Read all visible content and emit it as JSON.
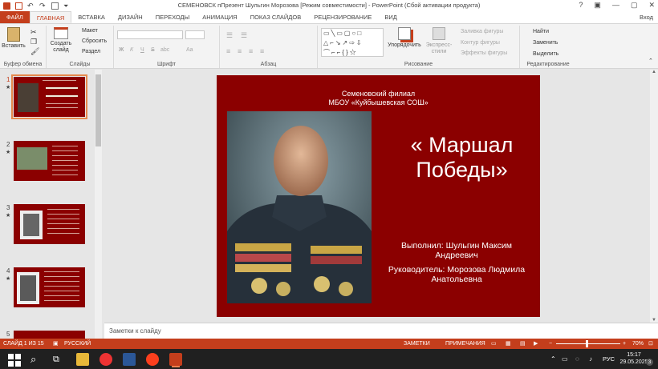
{
  "window": {
    "title": "СЕМЕНОВСК  пПрезент Шульгин Морозова [Режим совместимости] - PowerPoint (Сбой активации продукта)",
    "controls": [
      "?",
      "▣",
      "—",
      "▢",
      "✕"
    ]
  },
  "tabs": [
    {
      "label": "ФАЙЛ"
    },
    {
      "label": "ГЛАВНАЯ"
    },
    {
      "label": "ВСТАВКА"
    },
    {
      "label": "ДИЗАЙН"
    },
    {
      "label": "ПЕРЕХОДЫ"
    },
    {
      "label": "АНИМАЦИЯ"
    },
    {
      "label": "ПОКАЗ СЛАЙДОВ"
    },
    {
      "label": "РЕЦЕНЗИРОВАНИЕ"
    },
    {
      "label": "ВИД"
    }
  ],
  "signin": "Вход",
  "ribbon": {
    "clipboard": {
      "label": "Буфер обмена",
      "paste": "Вставить"
    },
    "slides": {
      "label": "Слайды",
      "create": "Создать слайд",
      "layout": "Макет",
      "reset": "Сбросить",
      "section": "Раздел"
    },
    "font": {
      "label": "Шрифт",
      "bold": "Ж",
      "italic": "К",
      "underline": "Ч",
      "strike": "S",
      "abc": "abc",
      "aa": "Aa"
    },
    "paragraph": {
      "label": "Абзац"
    },
    "drawing": {
      "label": "Рисование",
      "arrange": "Упорядочить",
      "styles": "Экспресс-стили",
      "fill": "Заливка фигуры",
      "outline": "Контур фигуры",
      "effects": "Эффекты фигуры"
    },
    "editing": {
      "label": "Редактирование",
      "find": "Найти",
      "replace": "Заменить",
      "select": "Выделить"
    }
  },
  "thumbnails": [
    {
      "num": "1",
      "star": "★"
    },
    {
      "num": "2",
      "star": "★"
    },
    {
      "num": "3",
      "star": "★"
    },
    {
      "num": "4",
      "star": "★"
    },
    {
      "num": "5",
      "star": ""
    }
  ],
  "slide": {
    "subtitle1": "Семеновский филиал",
    "subtitle2": "МБОУ «Куйбышевская СОШ»",
    "title1": "« Маршал",
    "title2": "Победы»",
    "author1": "Выполнил: Шульгин Максим",
    "author2": "Андреевич",
    "author3": "Руководитель: Морозова Людмила",
    "author4": "Анатольевна"
  },
  "notes": "Заметки к слайду",
  "status": {
    "slide": "СЛАЙД 1 ИЗ 15",
    "lang": "РУССКИЙ",
    "notes": "ЗАМЕТКИ",
    "comments": "ПРИМЕЧАНИЯ",
    "zoom": "70%"
  },
  "taskbar": {
    "lang": "РУС",
    "time": "15:17",
    "date": "29.05.2025",
    "notif": "3"
  },
  "colors": {
    "accent": "#c43e1c",
    "slide_bg": "#8b0000"
  }
}
